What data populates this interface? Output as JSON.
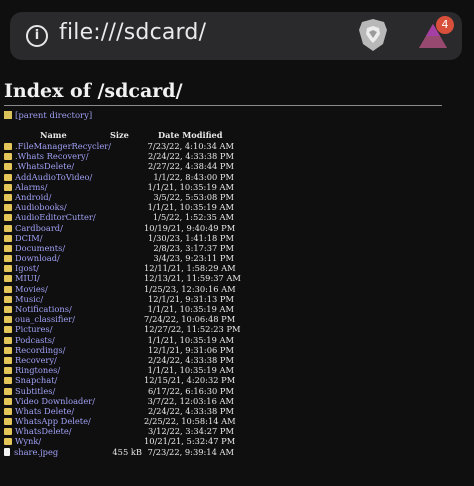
{
  "browser": {
    "url": "file:///sdcard/",
    "notification_count": "4"
  },
  "listing": {
    "title": "Index of /sdcard/",
    "parent_label": "[parent directory]",
    "headers": {
      "name": "Name",
      "size": "Size",
      "date": "Date Modified"
    },
    "rows": [
      {
        "name": ".FileManagerRecycler/",
        "size": "",
        "date": "7/23/22, 4:10:34 AM",
        "type": "folder"
      },
      {
        "name": ".Whats Recovery/",
        "size": "",
        "date": "2/24/22, 4:33:38 PM",
        "type": "folder"
      },
      {
        "name": ".WhatsDelete/",
        "size": "",
        "date": "2/27/22, 4:38:44 PM",
        "type": "folder"
      },
      {
        "name": "AddAudioToVideo/",
        "size": "",
        "date": "1/1/22, 8:43:00 PM",
        "type": "folder"
      },
      {
        "name": "Alarms/",
        "size": "",
        "date": "1/1/21, 10:35:19 AM",
        "type": "folder"
      },
      {
        "name": "Android/",
        "size": "",
        "date": "3/5/22, 5:53:08 PM",
        "type": "folder"
      },
      {
        "name": "Audiobooks/",
        "size": "",
        "date": "1/1/21, 10:35:19 AM",
        "type": "folder"
      },
      {
        "name": "AudioEditorCutter/",
        "size": "",
        "date": "1/5/22, 1:52:35 AM",
        "type": "folder"
      },
      {
        "name": "Cardboard/",
        "size": "",
        "date": "10/19/21, 9:40:49 PM",
        "type": "folder"
      },
      {
        "name": "DCIM/",
        "size": "",
        "date": "1/30/23, 1:41:18 PM",
        "type": "folder"
      },
      {
        "name": "Documents/",
        "size": "",
        "date": "2/8/23, 3:17:37 PM",
        "type": "folder"
      },
      {
        "name": "Download/",
        "size": "",
        "date": "3/4/23, 9:23:11 PM",
        "type": "folder"
      },
      {
        "name": "Igost/",
        "size": "",
        "date": "12/11/21, 1:58:29 AM",
        "type": "folder"
      },
      {
        "name": "MIUI/",
        "size": "",
        "date": "12/13/21, 11:59:37 AM",
        "type": "folder"
      },
      {
        "name": "Movies/",
        "size": "",
        "date": "1/25/23, 12:30:16 AM",
        "type": "folder"
      },
      {
        "name": "Music/",
        "size": "",
        "date": "12/1/21, 9:31:13 PM",
        "type": "folder"
      },
      {
        "name": "Notifications/",
        "size": "",
        "date": "1/1/21, 10:35:19 AM",
        "type": "folder"
      },
      {
        "name": "oua_classifier/",
        "size": "",
        "date": "7/24/22, 10:06:48 PM",
        "type": "folder"
      },
      {
        "name": "Pictures/",
        "size": "",
        "date": "12/27/22, 11:52:23 PM",
        "type": "folder"
      },
      {
        "name": "Podcasts/",
        "size": "",
        "date": "1/1/21, 10:35:19 AM",
        "type": "folder"
      },
      {
        "name": "Recordings/",
        "size": "",
        "date": "12/1/21, 9:31:06 PM",
        "type": "folder"
      },
      {
        "name": "Recovery/",
        "size": "",
        "date": "2/24/22, 4:33:38 PM",
        "type": "folder"
      },
      {
        "name": "Ringtones/",
        "size": "",
        "date": "1/1/21, 10:35:19 AM",
        "type": "folder"
      },
      {
        "name": "Snapchat/",
        "size": "",
        "date": "12/15/21, 4:20:32 PM",
        "type": "folder"
      },
      {
        "name": "Subtitles/",
        "size": "",
        "date": "6/17/22, 6:16:30 PM",
        "type": "folder"
      },
      {
        "name": "Video Downloader/",
        "size": "",
        "date": "3/7/22, 12:03:16 AM",
        "type": "folder"
      },
      {
        "name": "Whats Delete/",
        "size": "",
        "date": "2/24/22, 4:33:38 PM",
        "type": "folder"
      },
      {
        "name": "WhatsApp Delete/",
        "size": "",
        "date": "2/25/22, 10:58:14 AM",
        "type": "folder"
      },
      {
        "name": "WhatsDelete/",
        "size": "",
        "date": "3/12/22, 3:34:27 PM",
        "type": "folder"
      },
      {
        "name": "Wynk/",
        "size": "",
        "date": "10/21/21, 5:32:47 PM",
        "type": "folder"
      },
      {
        "name": "share.jpeg",
        "size": "455 kB",
        "date": "7/23/22, 9:39:14 AM",
        "type": "file"
      }
    ]
  }
}
